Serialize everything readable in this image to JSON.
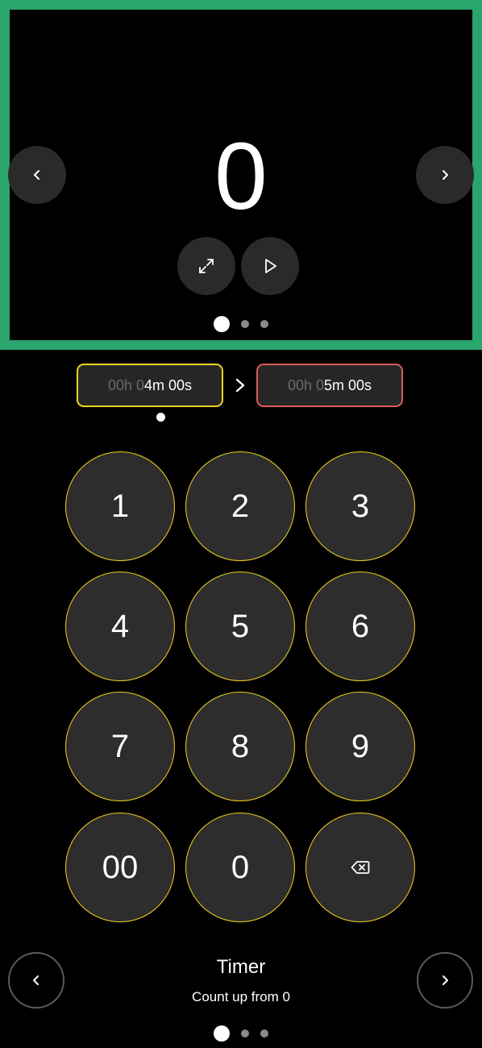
{
  "preview": {
    "display_value": "0",
    "prev_icon": "chevron-left-icon",
    "next_icon": "chevron-right-icon",
    "expand_icon": "expand-icon",
    "play_icon": "play-icon",
    "accent_color": "#2aa56b",
    "pager": {
      "count": 3,
      "active_index": 0
    }
  },
  "range": {
    "start": {
      "h_dim": "00h 0",
      "m_bright": "4m 00s"
    },
    "end": {
      "h_dim": "00h 0",
      "m_bright": "5m 00s"
    },
    "start_color": "#f2d31f",
    "end_color": "#dc5b5b",
    "arrow_icon": "chevron-right-icon"
  },
  "keypad": {
    "keys": [
      "1",
      "2",
      "3",
      "4",
      "5",
      "6",
      "7",
      "8",
      "9",
      "00",
      "0"
    ],
    "backspace_icon": "backspace-icon",
    "key_border_color": "#f2d31f"
  },
  "mode": {
    "title": "Timer",
    "subtitle": "Count up from 0",
    "prev_icon": "chevron-left-icon",
    "next_icon": "chevron-right-icon",
    "pager": {
      "count": 3,
      "active_index": 0
    }
  }
}
